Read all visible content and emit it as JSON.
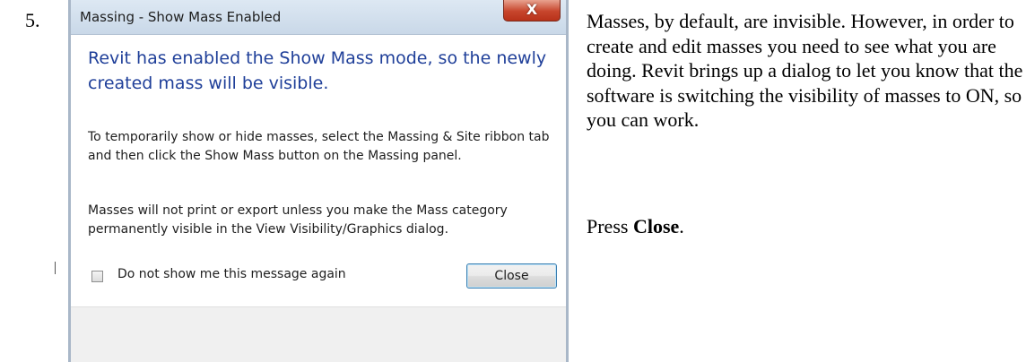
{
  "step": {
    "number": "5."
  },
  "dialog": {
    "title": "Massing - Show Mass Enabled",
    "close_x_label": "X",
    "main_instruction": "Revit has enabled the Show Mass mode, so the newly created mass will be visible.",
    "paragraph_1": "To temporarily show or hide masses, select the Massing & Site ribbon tab and then click the Show Mass button on the Massing panel.",
    "paragraph_2": "Masses will not print or export unless you make the Mass category permanently visible in the View Visibility/Graphics dialog.",
    "checkbox_label": "Do not show me this message again",
    "checkbox_checked": false,
    "close_button_label": "Close"
  },
  "instructions": {
    "paragraph": "Masses, by default, are invisible. However, in order to create and edit masses you need to see what you are doing.  Revit brings up a dialog to let you know that the software is switching the visibility of masses to ON, so you can work.",
    "press_prefix": "Press ",
    "press_target": "Close",
    "press_suffix": "."
  },
  "colors": {
    "main_instruction_blue": "#1f3f99",
    "close_x_red": "#c7452c",
    "title_bar": "#dde8f3"
  }
}
